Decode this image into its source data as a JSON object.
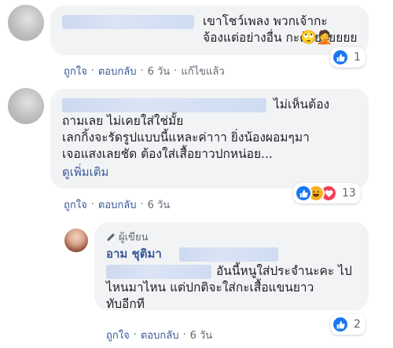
{
  "comments": [
    {
      "text": "เขาโชว์เพลง พวกเจ้ากะ\nจ้องแต่อย่างอื่น กะด้ายยยยยย",
      "actions": {
        "like": "ถูกใจ",
        "reply": "ตอบกลับ",
        "time": "6 วัน",
        "edited": "แก้ไขแล้ว"
      },
      "reaction_count": "1"
    },
    {
      "text_first": "ไม่เห็นต้อง",
      "text": "ถามเลย ไม่เคยใส่ใช่มั้ย\nเลกกิ้งจะรัดรูปแบบนี้แหละค่าาา ยิ่งน้องผอมๆมา\nเจอแสงเลยชัด ต้องใส่เสื้อยาวปกหน่อย...",
      "see_more": "ดูเพิ่มเติม",
      "actions": {
        "like": "ถูกใจ",
        "reply": "ตอบกลับ",
        "time": "6 วัน"
      },
      "reaction_count": "13"
    }
  ],
  "reply": {
    "author_badge": "ผู้เขียน",
    "author_name": "อาม ชุติมา",
    "text_first": "อันนี้หนูใส่ประจำนะคะ ไป",
    "text": "ไหนมาไหน แต่ปกติจะใส่กะเสื้อแขนยาว\nทับอีกที",
    "actions": {
      "like": "ถูกใจ",
      "reply": "ตอบกลับ",
      "time": "6 วัน"
    },
    "reaction_count": "2"
  },
  "colors": {
    "like_blue": "#1877f2",
    "link": "#385898",
    "bubble": "#f2f3f5",
    "haha_yellow": "#f7b125",
    "love_red": "#f33e58"
  },
  "emoji": {
    "rolling_eyes": "🙄",
    "person_facepalm": "🤦"
  }
}
